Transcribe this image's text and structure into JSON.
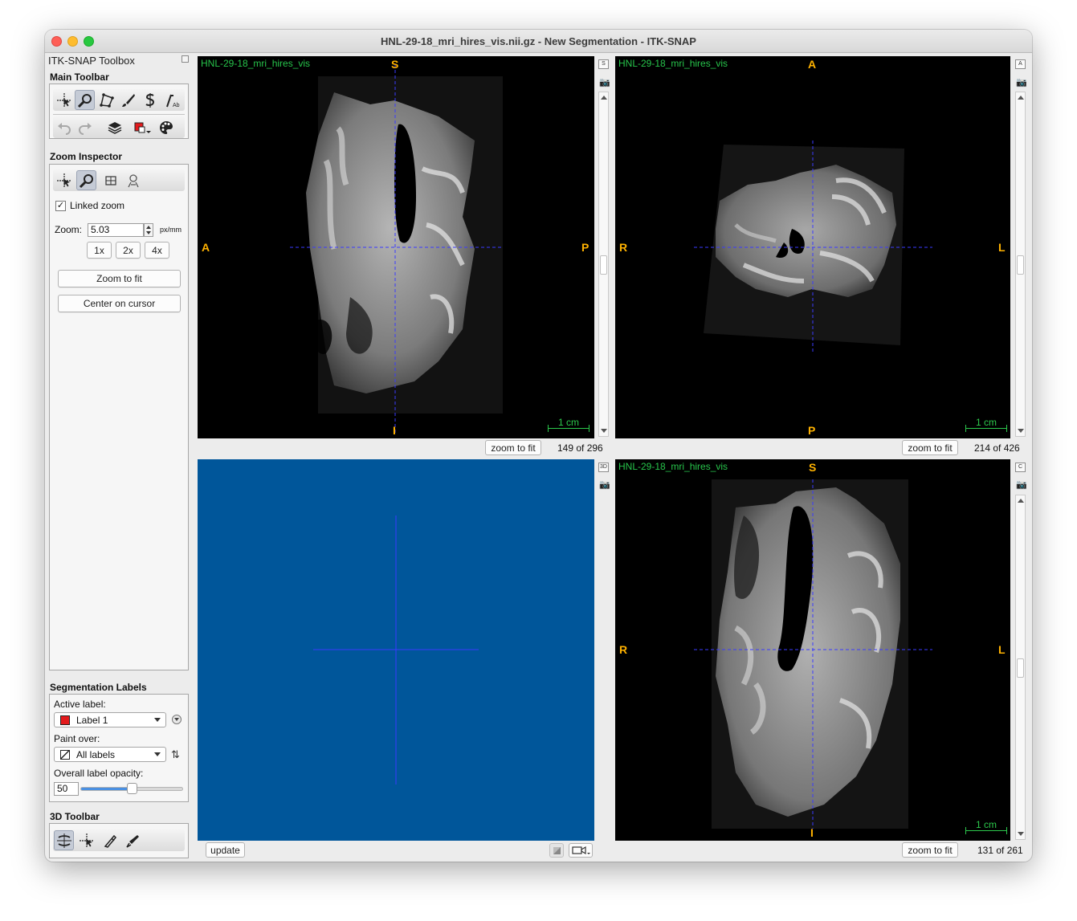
{
  "window": {
    "title": "HNL-29-18_mri_hires_vis.nii.gz - New Segmentation - ITK-SNAP"
  },
  "toolbox": {
    "title": "ITK-SNAP Toolbox",
    "main_toolbar": {
      "label": "Main Toolbar"
    },
    "zoom_inspector": {
      "label": "Zoom Inspector",
      "linked_zoom_label": "Linked zoom",
      "linked_zoom_checked": "✓",
      "zoom_label": "Zoom:",
      "zoom_value": "5.03",
      "zoom_unit": "px/mm",
      "zoom_1x": "1x",
      "zoom_2x": "2x",
      "zoom_4x": "4x",
      "zoom_to_fit": "Zoom to fit",
      "center_on_cursor": "Center on cursor"
    },
    "segmentation_labels": {
      "label": "Segmentation Labels",
      "active_label_caption": "Active label:",
      "active_label_value": "Label 1",
      "active_label_color": "#e31a1c",
      "paint_over_caption": "Paint over:",
      "paint_over_value": "All labels",
      "opacity_caption": "Overall label opacity:",
      "opacity_value": "50"
    },
    "toolbar_3d": {
      "label": "3D Toolbar"
    }
  },
  "views": {
    "sagittal": {
      "name": "HNL-29-18_mri_hires_vis",
      "top": "S",
      "bottom": "I",
      "left": "A",
      "right": "P",
      "scale": "1 cm",
      "zoom_button": "zoom to fit",
      "slice": "149 of 296",
      "side_button": "S"
    },
    "axial": {
      "name": "HNL-29-18_mri_hires_vis",
      "top": "A",
      "bottom": "P",
      "left": "R",
      "right": "L",
      "scale": "1 cm",
      "zoom_button": "zoom to fit",
      "slice": "214 of 426",
      "side_button": "A"
    },
    "render3d": {
      "update_button": "update",
      "side_button": "3D",
      "background": "#00569a"
    },
    "coronal": {
      "name": "HNL-29-18_mri_hires_vis",
      "top": "S",
      "bottom": "I",
      "left": "R",
      "right": "L",
      "scale": "1 cm",
      "zoom_button": "zoom to fit",
      "slice": "131 of 261",
      "side_button": "C"
    }
  },
  "colors": {
    "accent_label": "#27c44b",
    "orientation": "#ffb200",
    "crosshair": "#3a3aff"
  }
}
